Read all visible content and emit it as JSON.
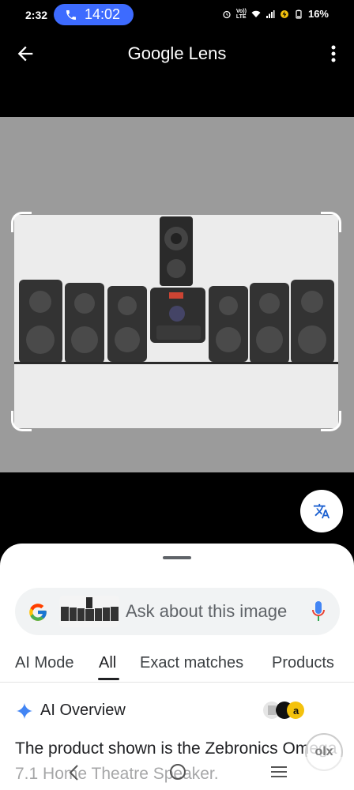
{
  "status_bar": {
    "time": "2:32",
    "call_timer": "14:02",
    "network_label_1": "Vo))",
    "network_label_2": "LTE",
    "battery_percent": "16%"
  },
  "app_bar": {
    "title": "Google Lens"
  },
  "search": {
    "placeholder": "Ask about this image"
  },
  "tabs": [
    {
      "label": "AI Mode"
    },
    {
      "label": "All",
      "active": true
    },
    {
      "label": "Exact matches"
    },
    {
      "label": "Products"
    }
  ],
  "ai_overview": {
    "title": "AI Overview",
    "text": "The product shown is the Zebronics Omega 7.1 Home Theatre Speaker."
  },
  "watermark": {
    "text": "olx"
  },
  "colors": {
    "accent": "#3d6bff",
    "google_blue": "#4285f4",
    "image_bg": "#9b9b9b"
  }
}
